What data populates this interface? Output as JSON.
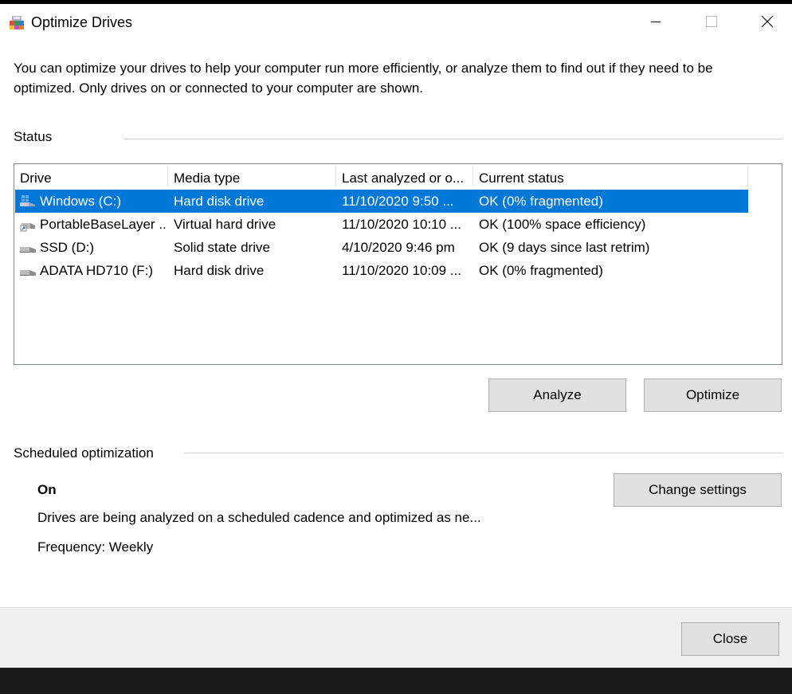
{
  "window": {
    "title": "Optimize Drives"
  },
  "intro_text": "You can optimize your drives to help your computer run more efficiently, or analyze them to find out if they need to be optimized. Only drives on or connected to your computer are shown.",
  "status": {
    "label": "Status",
    "columns": [
      "Drive",
      "Media type",
      "Last analyzed or o...",
      "Current status"
    ],
    "rows": [
      {
        "drive": "Windows (C:)",
        "media_type": "Hard disk drive",
        "last_analyzed": "11/10/2020 9:50 ...",
        "current_status": "OK (0% fragmented)",
        "icon": "windows-drive-icon",
        "selected": true
      },
      {
        "drive": "PortableBaseLayer ...",
        "media_type": "Virtual hard drive",
        "last_analyzed": "11/10/2020 10:10 ...",
        "current_status": "OK (100% space efficiency)",
        "icon": "virtual-drive-icon",
        "selected": false
      },
      {
        "drive": "SSD (D:)",
        "media_type": "Solid state drive",
        "last_analyzed": "4/10/2020 9:46 pm",
        "current_status": "OK (9 days since last retrim)",
        "icon": "drive-icon",
        "selected": false
      },
      {
        "drive": "ADATA HD710 (F:)",
        "media_type": "Hard disk drive",
        "last_analyzed": "11/10/2020 10:09 ...",
        "current_status": "OK (0% fragmented)",
        "icon": "drive-icon",
        "selected": false
      }
    ],
    "analyze_label": "Analyze",
    "optimize_label": "Optimize"
  },
  "scheduled": {
    "label": "Scheduled optimization",
    "state": "On",
    "description": "Drives are being analyzed on a scheduled cadence and optimized as ne...",
    "frequency": "Frequency: Weekly",
    "change_settings_label": "Change settings"
  },
  "footer": {
    "close_label": "Close"
  },
  "colors": {
    "selection": "#0078d7",
    "button_bg": "#e1e1e1",
    "footer_bg": "#f0f0f0"
  }
}
